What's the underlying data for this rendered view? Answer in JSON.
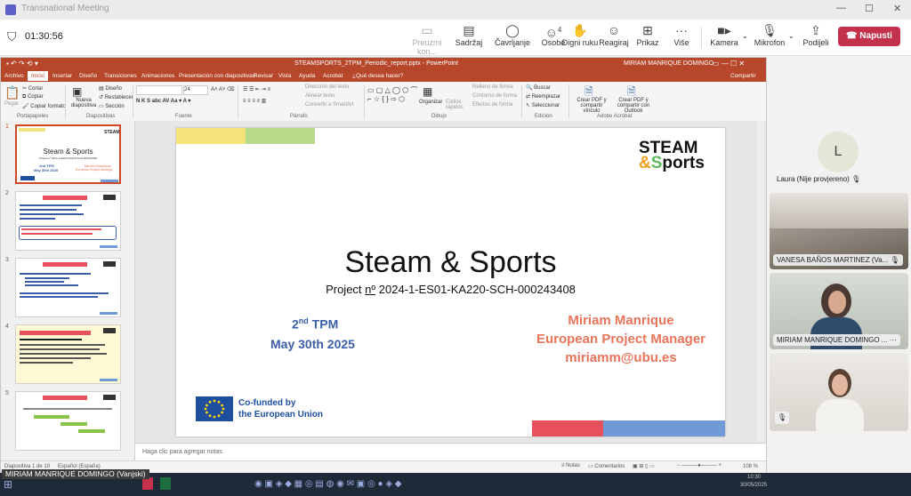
{
  "teams": {
    "title": "Transnational Meeting",
    "timer": "01:30:56",
    "toolbar": [
      {
        "label": "Preuzmi kon...",
        "icon": "share-tray-icon",
        "dim": true
      },
      {
        "label": "Sadržaj",
        "icon": "content-icon"
      },
      {
        "label": "Čavrljanje",
        "icon": "chat-icon"
      },
      {
        "label": "Osobe",
        "icon": "people-icon",
        "badge": "4"
      },
      {
        "label": "Digni ruku",
        "icon": "raise-hand-icon"
      },
      {
        "label": "Reagiraj",
        "icon": "emoji-icon"
      },
      {
        "label": "Prikaz",
        "icon": "view-icon"
      },
      {
        "label": "Više",
        "icon": "more-icon"
      },
      {
        "label": "Kamera",
        "icon": "camera-icon"
      },
      {
        "label": "Mikrofon",
        "icon": "mic-off-icon"
      },
      {
        "label": "Podijeli",
        "icon": "share-icon"
      }
    ],
    "leave_label": "Napusti",
    "participants": [
      {
        "name": "Laura (Nije provjereno)",
        "initial": "L"
      },
      {
        "name": "VANESA BAÑOS MARTINEZ (Va..."
      },
      {
        "name": "MIRIAM MANRIQUE DOMINGO ..."
      }
    ],
    "caller_label": "MIRIAM MANRIQUE DOMINGO (Vanjski)"
  },
  "ppt": {
    "title": "STEAMSPORTS_2TPM_Periodic_report.pptx - PowerPoint",
    "user": "MIRIAM MANRIQUE DOMINGO",
    "tabs": [
      "Archivo",
      "Inicio",
      "Insertar",
      "Diseño",
      "Transiciones",
      "Animaciones",
      "Presentación con diapositivas",
      "Revisar",
      "Vista",
      "Ayuda",
      "Acrobat",
      "¿Qué desea hacer?"
    ],
    "share": "Compartir",
    "ribbon": {
      "paste": "Pegar",
      "cut": "Cortar",
      "copy": "Copiar",
      "format_painter": "Copiar formato",
      "new_slide": "Nueva diapositiva",
      "layout": "Diseño",
      "reset": "Restablecer",
      "section": "Sección",
      "font_size": "24",
      "text_direction": "Dirección del texto",
      "align_text": "Alinear texto",
      "smartart": "Convertir a SmartArt",
      "arrange": "Organizar",
      "quick_styles": "Estilos rápidos",
      "shape_fill": "Relleno de forma",
      "shape_outline": "Contorno de forma",
      "shape_effects": "Efectos de forma",
      "find": "Buscar",
      "replace": "Reemplazar",
      "select": "Seleccionar",
      "pdf1": "Crear PDF y compartir vínculo",
      "pdf2": "Crear PDF y compartir con Outlook",
      "groups": [
        "Portapapeles",
        "Diapositivas",
        "Fuente",
        "Párrafo",
        "Dibujo",
        "Edición",
        "Adobe Acrobat"
      ]
    },
    "slide_numbers": [
      "1",
      "2",
      "3",
      "4",
      "5"
    ],
    "notes_placeholder": "Haga clic para agregar notas",
    "status": {
      "slide_of": "Diapositiva 1 de 10",
      "lang": "Español (España)",
      "notes": "Notas",
      "comments": "Comentarios",
      "zoom": "108 %"
    },
    "thumb1": {
      "title": "Steam & Sports",
      "tpm": "2nd TPM",
      "date": "May 30th 2025",
      "name": "Miriam Manrique",
      "role": "European Project Manager"
    }
  },
  "slide": {
    "title": "Steam & Sports",
    "project_prefix": "Project ",
    "project_no": "nº",
    "project_code": " 2024-1-ES01-KA220-SCH-000243408",
    "tpm_num": "2",
    "tpm_sup": "nd",
    "tpm_rest": " TPM",
    "date": "May 30th 2025",
    "presenter": "Miriam Manrique",
    "role": "European Project Manager",
    "email": "miriamm@ubu.es",
    "logo_top": "STEAM",
    "logo_amp": "&",
    "logo_s": "S",
    "logo_rest": "ports",
    "eu_line1": "Co-funded by",
    "eu_line2": "the European Union"
  },
  "colors": {
    "ppt_red": "#b7472a",
    "leave_red": "#c4314b",
    "slide_orange": "#e8745a",
    "slide_blue": "#3b5ea8",
    "bar_yellow": "#f4e27a",
    "bar_green": "#b9d98a",
    "bar_red": "#e8505b",
    "bar_blue": "#6f9ad6"
  },
  "taskbar": {
    "time": "10:30",
    "date": "30/05/2025"
  }
}
